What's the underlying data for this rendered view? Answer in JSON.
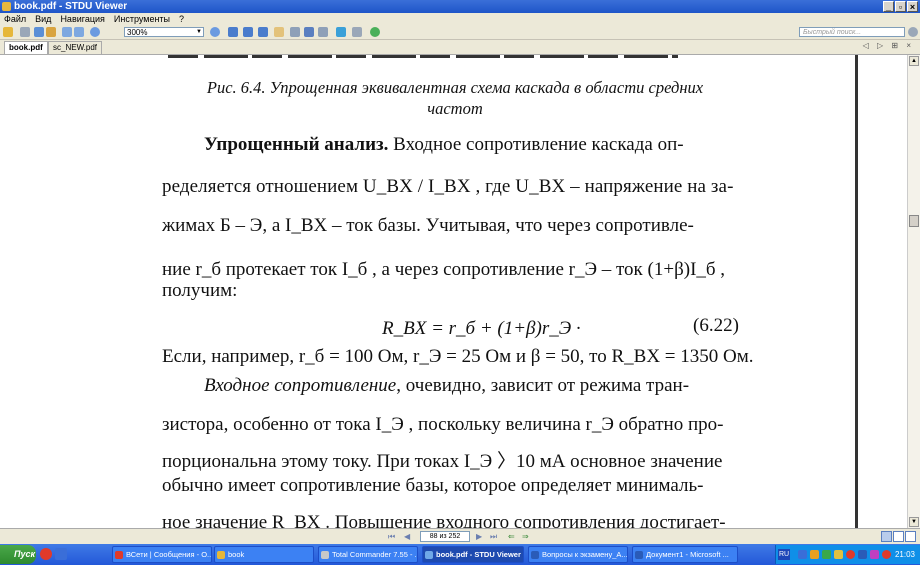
{
  "window": {
    "title": "book.pdf - STDU Viewer",
    "controls": [
      "_",
      "▫",
      "×"
    ]
  },
  "menu": [
    "Файл",
    "Вид",
    "Навигация",
    "Инструменты",
    "?"
  ],
  "toolbar": {
    "zoom_value": "300%",
    "search_placeholder": "Быстрый поиск..."
  },
  "tabs": [
    {
      "label": "book.pdf"
    },
    {
      "label": "sc_NEW.pdf"
    }
  ],
  "tab_controls": "◁ ▷ ⊞ ×",
  "document": {
    "caption_line1": "Рис. 6.4. Упрощенная эквивалентная схема каскада в области средних",
    "caption_line2": "частот",
    "l1_bold": "Упрощенный анализ.",
    "l1_rest": " Входное сопротивление каскада оп-",
    "l2": "ределяется отношением U_BX / I_BX , где U_BX – напряжение на за-",
    "l3": "жимах Б – Э, а I_BX – ток базы. Учитывая, что через сопротивле-",
    "l4": "ние r_б протекает ток I_б , а через сопротивление r_Э – ток (1+β)I_б ,",
    "l5": "получим:",
    "formula": "R_BX = r_б + (1+β)r_Э ·",
    "formula_number": "(6.22)",
    "l6": "Если, например, r_б = 100 Ом, r_Э = 25 Ом и β = 50, то R_BX = 1350 Ом.",
    "l7_italic": "Входное сопротивление",
    "l7_rest": ", очевидно, зависит от режима тран-",
    "l8": "зистора, особенно от тока I_Э , поскольку величина r_Э обратно про-",
    "l9": "порциональна этому току. При токах I_Э 〉10 мА основное значение",
    "l10": "обычно имеет сопротивление базы, которое определяет минималь-",
    "l11": "ное значение R_BX . Повышение входного сопротивления достигает-"
  },
  "navigation": {
    "page_indicator": "88 из 252"
  },
  "taskbar": {
    "start_label": "Пуск",
    "tasks": [
      "ВСети | Сообщения - О...",
      "book",
      "Total Commander 7.55 - ...",
      "book.pdf - STDU Viewer",
      "Вопросы к экзамену_А...",
      "Документ1 - Microsoft ..."
    ],
    "language": "RU",
    "clock": "21:03"
  }
}
